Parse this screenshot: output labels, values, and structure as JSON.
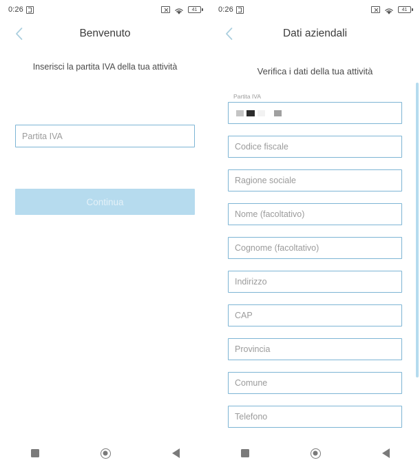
{
  "status_bar": {
    "time": "0:26",
    "nfc_icon": "nfc-icon",
    "mute_icon": "mute-icon",
    "wifi_icon": "wifi-icon",
    "battery_level": "41",
    "battery_icon": "battery-icon"
  },
  "colors": {
    "field_border": "#7cb4d4",
    "button_disabled_bg": "#b6dbee",
    "button_disabled_text": "#e4f1f8",
    "scrollbar": "#b5dcef",
    "chevron": "#a9cede",
    "nav_icons": "#7a7a7a"
  },
  "left_screen": {
    "back_icon": "chevron-left-icon",
    "title": "Benvenuto",
    "subtitle": "Inserisci la partita IVA della tua attività",
    "vat_input": {
      "placeholder": "Partita IVA",
      "value": ""
    },
    "continue_button": {
      "label": "Continua",
      "enabled": false
    }
  },
  "right_screen": {
    "back_icon": "chevron-left-icon",
    "title": "Dati aziendali",
    "subtitle": "Verifica i dati della tua attività",
    "vat_field": {
      "floating_label": "Partita IVA",
      "value_redacted": true,
      "redaction_blocks": [
        {
          "width": 11,
          "color": "#c4c4c4"
        },
        {
          "width": 12,
          "color": "#2b2b2b"
        },
        {
          "width": 11,
          "color": "#f2f2f2"
        },
        {
          "width": 5,
          "color": "#ffffff"
        },
        {
          "width": 11,
          "color": "#a0a0a0"
        }
      ]
    },
    "fields": [
      {
        "placeholder": "Codice fiscale",
        "value": ""
      },
      {
        "placeholder": "Ragione sociale",
        "value": ""
      },
      {
        "placeholder": "Nome (facoltativo)",
        "value": ""
      },
      {
        "placeholder": "Cognome (facoltativo)",
        "value": ""
      },
      {
        "placeholder": "Indirizzo",
        "value": ""
      },
      {
        "placeholder": "CAP",
        "value": ""
      },
      {
        "placeholder": "Provincia",
        "value": ""
      },
      {
        "placeholder": "Comune",
        "value": ""
      },
      {
        "placeholder": "Telefono",
        "value": ""
      }
    ],
    "has_partial_field_below": true,
    "scrollbar_visible": true
  },
  "nav_bar": {
    "recents_icon": "square-recents-icon",
    "home_icon": "circle-home-icon",
    "back_icon": "triangle-back-icon"
  }
}
